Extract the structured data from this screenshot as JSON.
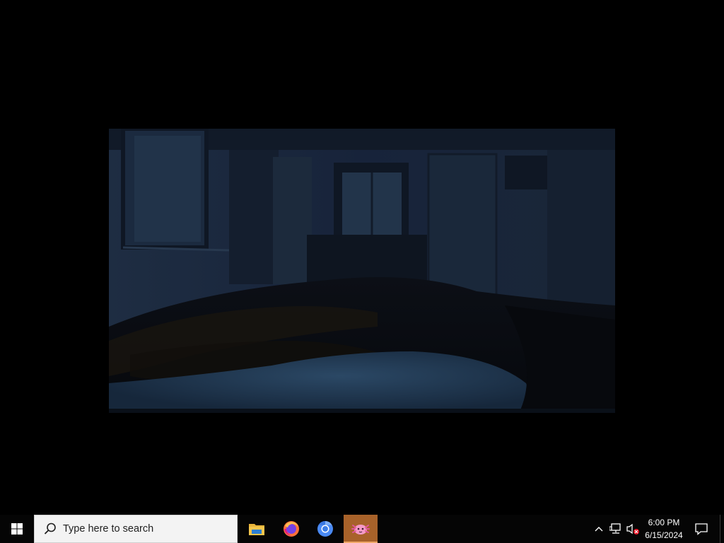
{
  "desktop": {
    "video": {
      "description_icon": "dim-bedroom-video-frame"
    }
  },
  "taskbar": {
    "start_icon": "windows-logo-icon",
    "search": {
      "placeholder": "Type here to search",
      "icon": "search-icon"
    },
    "apps": [
      {
        "name": "file-explorer",
        "icon": "folder-icon",
        "active": false
      },
      {
        "name": "firefox",
        "icon": "firefox-icon",
        "active": false
      },
      {
        "name": "chromium",
        "icon": "chromium-icon",
        "active": false
      },
      {
        "name": "media-player",
        "icon": "axolotl-icon",
        "active": true
      }
    ],
    "tray": {
      "chevron_icon": "chevron-up-icon",
      "network_icon": "network-icon",
      "volume_icon": "volume-muted-icon",
      "time": "6:00 PM",
      "date": "6/15/2024",
      "notifications_icon": "notification-icon"
    },
    "colors": {
      "taskbar_bg": "#050505",
      "active_app_bg": "#a8622a",
      "search_bg": "#f3f3f3"
    }
  }
}
